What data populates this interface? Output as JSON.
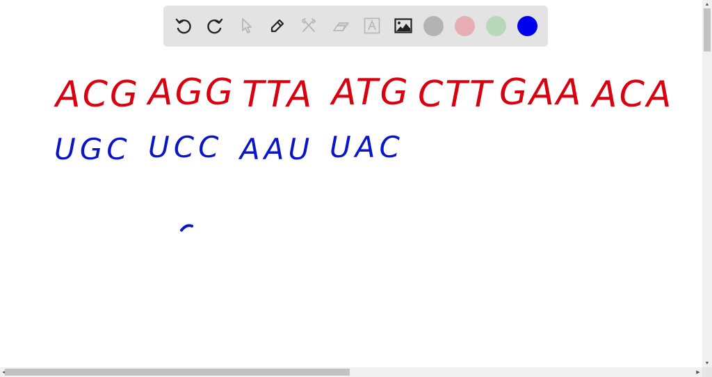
{
  "toolbar": {
    "tools": [
      {
        "name": "undo",
        "enabled": true
      },
      {
        "name": "redo",
        "enabled": true
      },
      {
        "name": "select",
        "enabled": false
      },
      {
        "name": "pen",
        "enabled": true
      },
      {
        "name": "tools",
        "enabled": false
      },
      {
        "name": "eraser",
        "enabled": false
      },
      {
        "name": "text",
        "enabled": false
      },
      {
        "name": "image",
        "enabled": true
      }
    ],
    "colors": [
      {
        "name": "gray",
        "hex": "#b3b3b3"
      },
      {
        "name": "pink",
        "hex": "#e6aeb2"
      },
      {
        "name": "green",
        "hex": "#b8d8b8"
      },
      {
        "name": "blue",
        "hex": "#0000ee",
        "selected": true
      }
    ]
  },
  "canvas": {
    "ink_colors": {
      "red": "#d9000f",
      "blue": "#0a14c8"
    },
    "line1": {
      "color": "red",
      "codons": [
        "ACG",
        "AGG",
        "TTA",
        "ATG",
        "CTT",
        "GAA",
        "ACA"
      ]
    },
    "line2": {
      "color": "blue",
      "codons": [
        "UGC",
        "UCC",
        "AAU",
        "UAC"
      ]
    }
  }
}
